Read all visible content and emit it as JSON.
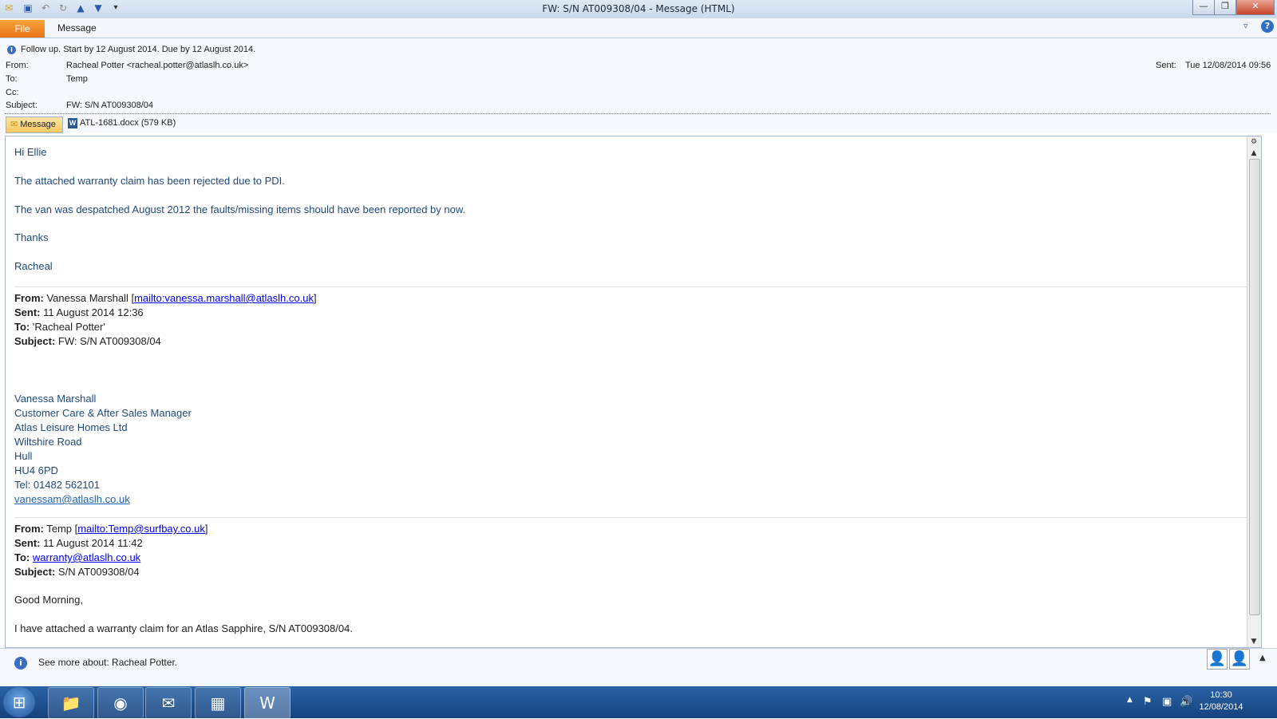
{
  "window": {
    "title": "FW: S/N AT009308/04  -  Message (HTML)",
    "minimize": "—",
    "maximize": "❐",
    "close": "✕"
  },
  "ribbon": {
    "tab_file": "File",
    "tab_message": "Message"
  },
  "header": {
    "follow_up": "Follow up.  Start by 12 August 2014.  Due by 12 August 2014.",
    "from_label": "From:",
    "from_value": "Racheal Potter <racheal.potter@atlaslh.co.uk>",
    "to_label": "To:",
    "to_value": "Temp",
    "cc_label": "Cc:",
    "subject_label": "Subject:",
    "subject_value": "FW: S/N AT009308/04",
    "sent_label": "Sent:",
    "sent_value": "Tue 12/08/2014 09:56"
  },
  "attachments": {
    "message_button": "Message",
    "file": "ATL-1681.docx (579 KB)"
  },
  "body": {
    "greeting": "Hi Ellie",
    "p1": "The attached warranty claim has been rejected due to PDI.",
    "p2": "The van was despatched August 2012 the faults/missing items should have been reported by now.",
    "thanks": "Thanks",
    "sign": "Racheal",
    "fwd1": {
      "from_label": "From:",
      "from_name": "Vanessa Marshall [",
      "from_link": "mailto:vanessa.marshall@atlaslh.co.uk",
      "from_close": "]",
      "sent_label": "Sent:",
      "sent_value": "11 August 2014 12:36",
      "to_label": "To:",
      "to_value": "'Racheal Potter'",
      "subject_label": "Subject:",
      "subject_value": "FW: S/N AT009308/04"
    },
    "signature": {
      "name": "Vanessa Marshall",
      "role": "Customer Care & After Sales Manager",
      "company": "Atlas Leisure Homes Ltd",
      "street": "Wiltshire Road",
      "city": "Hull",
      "postcode": "HU4 6PD",
      "tel": "Tel: 01482 562101",
      "email": "vanessam@atlaslh.co.uk"
    },
    "fwd2": {
      "from_label": "From:",
      "from_name": "Temp [",
      "from_link": "mailto:Temp@surfbay.co.uk",
      "from_close": "]",
      "sent_label": "Sent:",
      "sent_value": "11 August 2014 11:42",
      "to_label": "To:",
      "to_link": "warranty@atlaslh.co.uk",
      "subject_label": "Subject:",
      "subject_value": "S/N AT009308/04"
    },
    "good_morning": "Good Morning,",
    "last_line": "I have attached a warranty claim for an Atlas Sapphire, S/N AT009308/04."
  },
  "footer": {
    "see_more": "See more about: Racheal Potter."
  },
  "taskbar": {
    "time": "10:30",
    "date": "12/08/2014"
  }
}
